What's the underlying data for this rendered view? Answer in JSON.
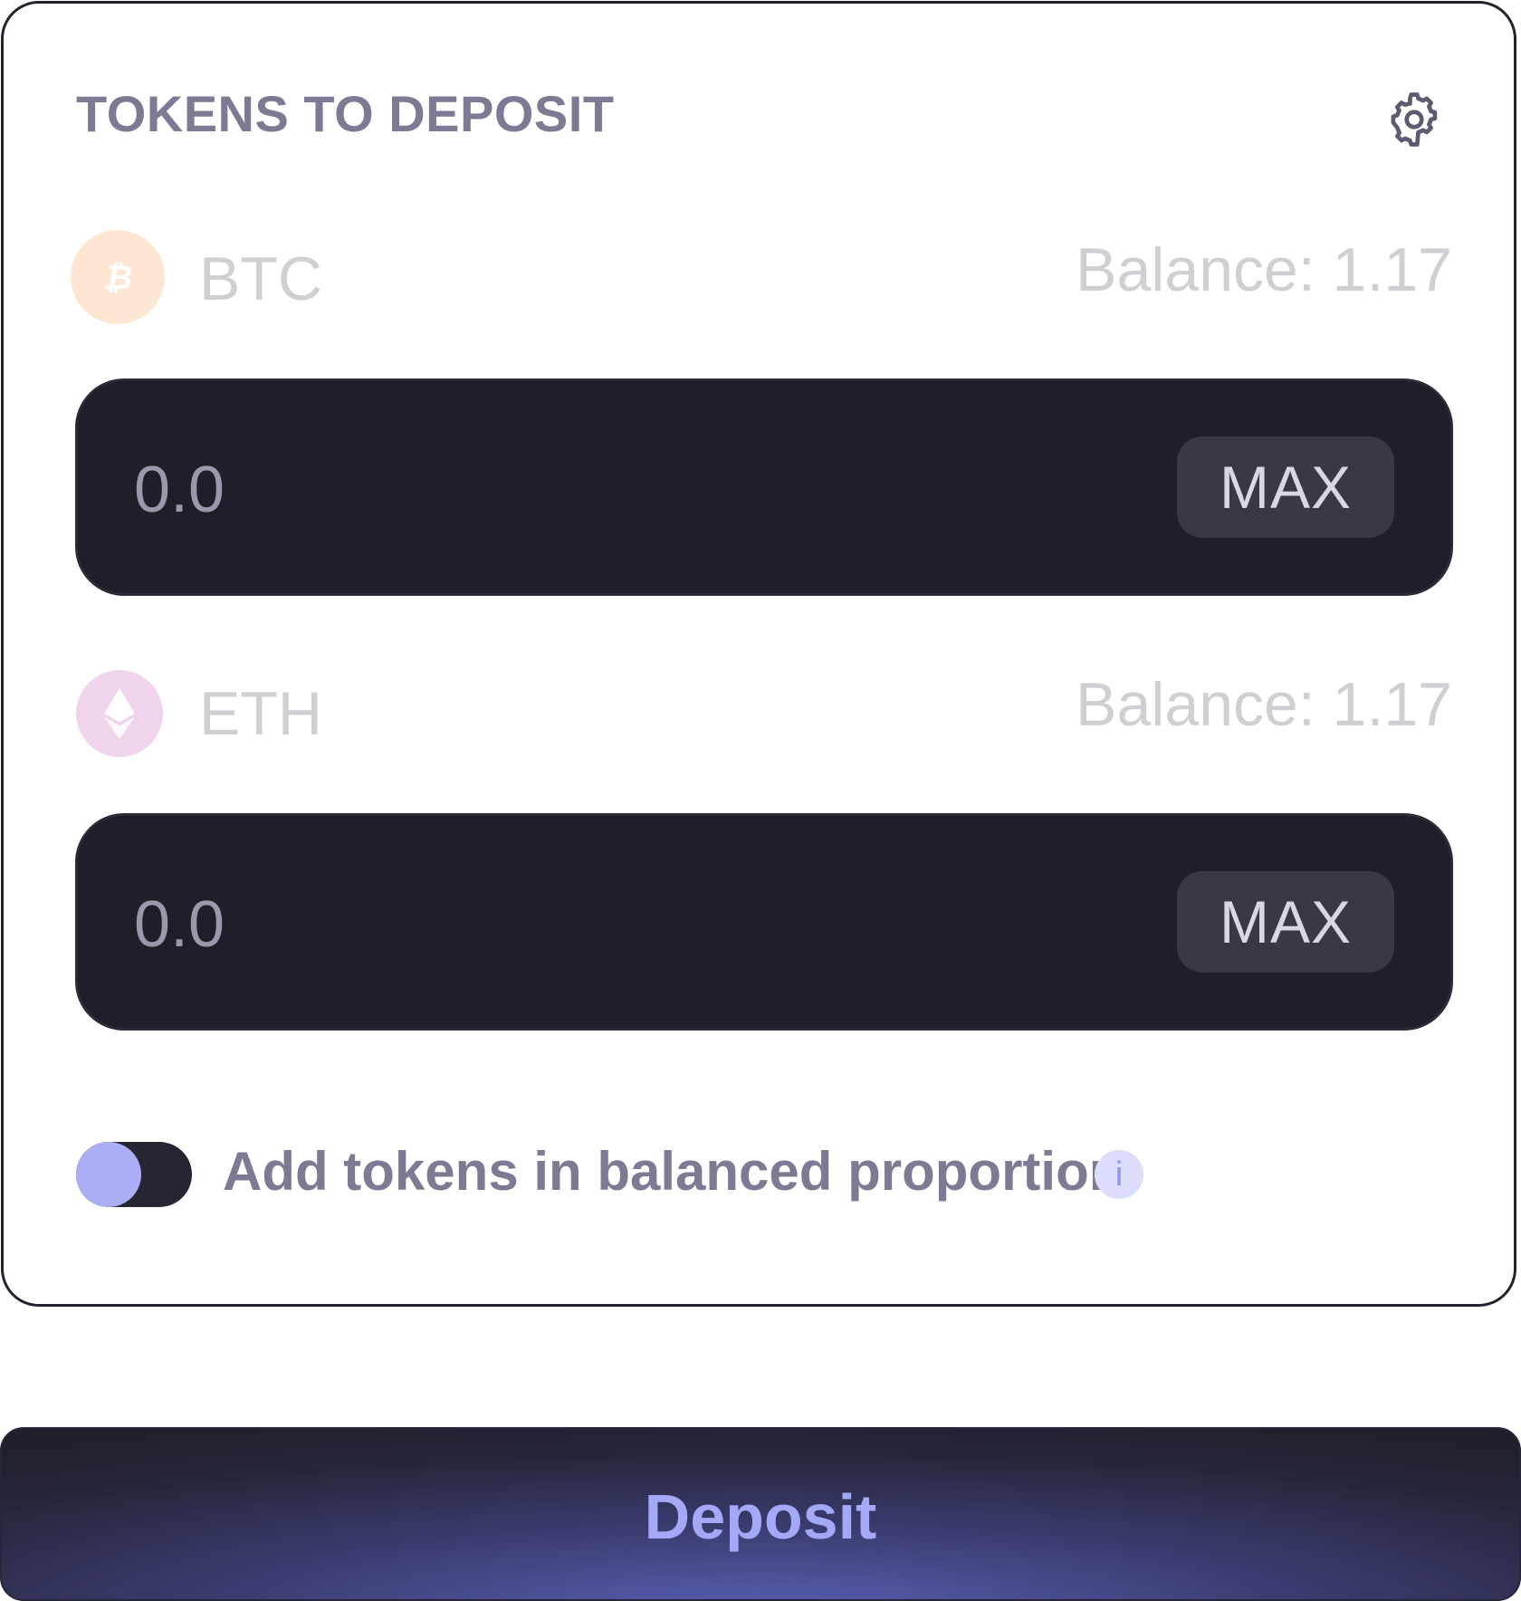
{
  "header": {
    "title": "TOKENS TO DEPOSIT",
    "settings_icon": "gear-icon"
  },
  "tokens": [
    {
      "symbol": "BTC",
      "icon": "bitcoin-icon",
      "icon_color": "#fde7d2",
      "balance_label": "Balance: 1.17",
      "amount_placeholder": "0.0",
      "max_label": "MAX"
    },
    {
      "symbol": "ETH",
      "icon": "ethereum-icon",
      "icon_color": "#efd4ec",
      "balance_label": "Balance: 1.17",
      "amount_placeholder": "0.0",
      "max_label": "MAX"
    }
  ],
  "balanced_toggle": {
    "label": "Add tokens in balanced proportion",
    "info_icon": "i",
    "on": false
  },
  "deposit_button": {
    "label": "Deposit"
  },
  "colors": {
    "accent": "#a4a8f7",
    "input_bg": "#1f1f2a",
    "muted_text": "#7c7b93"
  }
}
